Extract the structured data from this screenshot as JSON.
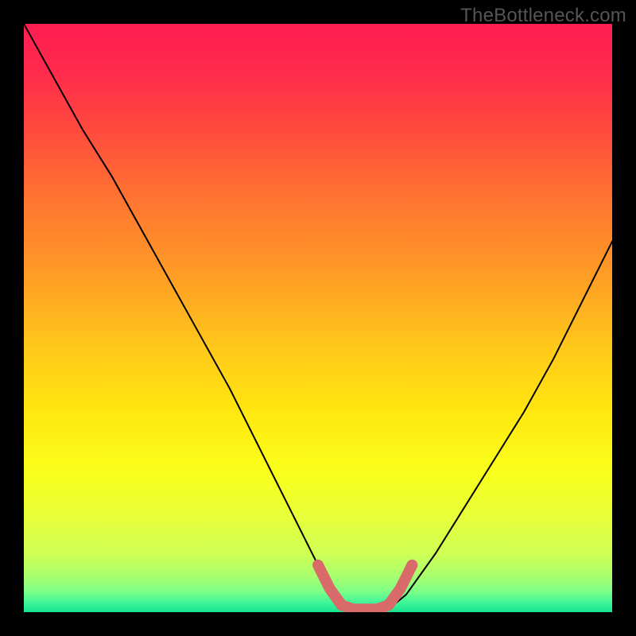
{
  "watermark": "TheBottleneck.com",
  "chart_data": {
    "type": "line",
    "title": "",
    "xlabel": "",
    "ylabel": "",
    "xlim": [
      0,
      100
    ],
    "ylim": [
      0,
      100
    ],
    "series": [
      {
        "name": "curve",
        "x": [
          0,
          5,
          10,
          15,
          20,
          25,
          30,
          35,
          40,
          45,
          50,
          53,
          56,
          59,
          62,
          65,
          70,
          75,
          80,
          85,
          90,
          95,
          100
        ],
        "y": [
          100,
          91,
          82,
          74,
          65,
          56,
          47,
          38,
          28,
          18,
          8,
          3,
          0.5,
          0.5,
          0.5,
          3,
          10,
          18,
          26,
          34,
          43,
          53,
          63
        ]
      },
      {
        "name": "highlight",
        "x": [
          50,
          52,
          54,
          56,
          58,
          60,
          62,
          64,
          66
        ],
        "y": [
          8,
          4,
          1.2,
          0.5,
          0.5,
          0.5,
          1.2,
          4,
          8
        ]
      }
    ],
    "gradient_stops": [
      {
        "offset": 0.0,
        "color": "#ff1d52"
      },
      {
        "offset": 0.08,
        "color": "#ff2a4c"
      },
      {
        "offset": 0.18,
        "color": "#ff4a3e"
      },
      {
        "offset": 0.3,
        "color": "#ff7531"
      },
      {
        "offset": 0.42,
        "color": "#ff9a26"
      },
      {
        "offset": 0.55,
        "color": "#ffc81a"
      },
      {
        "offset": 0.66,
        "color": "#ffe70f"
      },
      {
        "offset": 0.76,
        "color": "#faff1a"
      },
      {
        "offset": 0.84,
        "color": "#e6ff3a"
      },
      {
        "offset": 0.9,
        "color": "#cfff55"
      },
      {
        "offset": 0.94,
        "color": "#a7ff6f"
      },
      {
        "offset": 0.965,
        "color": "#7dff88"
      },
      {
        "offset": 0.985,
        "color": "#3bf59a"
      },
      {
        "offset": 1.0,
        "color": "#15e58f"
      }
    ],
    "curve_color": "#000000",
    "highlight_color": "#d86a6a"
  }
}
